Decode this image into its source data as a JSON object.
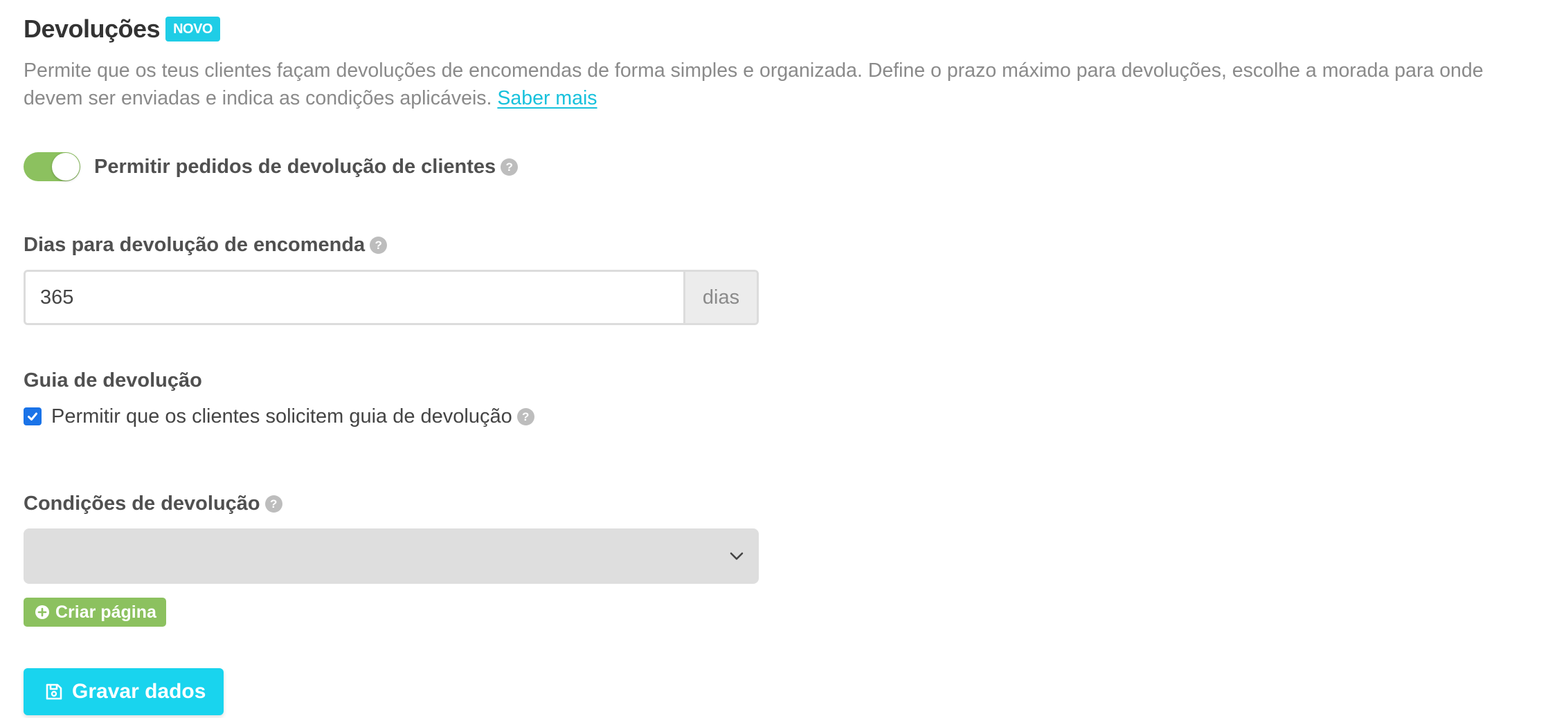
{
  "header": {
    "title": "Devoluções",
    "badge": "NOVO"
  },
  "description": {
    "text": "Permite que os teus clientes façam devoluções de encomendas de forma simples e organizada. Define o prazo máximo para devoluções, escolhe a morada para onde devem ser enviadas e indica as condições aplicáveis. ",
    "link_label": "Saber mais"
  },
  "allow_returns": {
    "label": "Permitir pedidos de devolução de clientes",
    "enabled": true,
    "help_icon": "question-circle-icon"
  },
  "return_days": {
    "label": "Dias para devolução de encomenda",
    "value": "365",
    "unit": "dias",
    "help_icon": "question-circle-icon"
  },
  "return_guide": {
    "heading": "Guia de devolução",
    "checkbox_label": "Permitir que os clientes solicitem guia de devolução",
    "checked": true,
    "help_icon": "question-circle-icon"
  },
  "return_conditions": {
    "label": "Condições de devolução",
    "selected": "",
    "create_page_label": "Criar página",
    "help_icon": "question-circle-icon"
  },
  "actions": {
    "save_label": "Gravar dados"
  },
  "colors": {
    "accent": "#19d4ee",
    "link": "#17c1dc",
    "toggle_on": "#8cc15f",
    "checkbox": "#1a73e8"
  }
}
